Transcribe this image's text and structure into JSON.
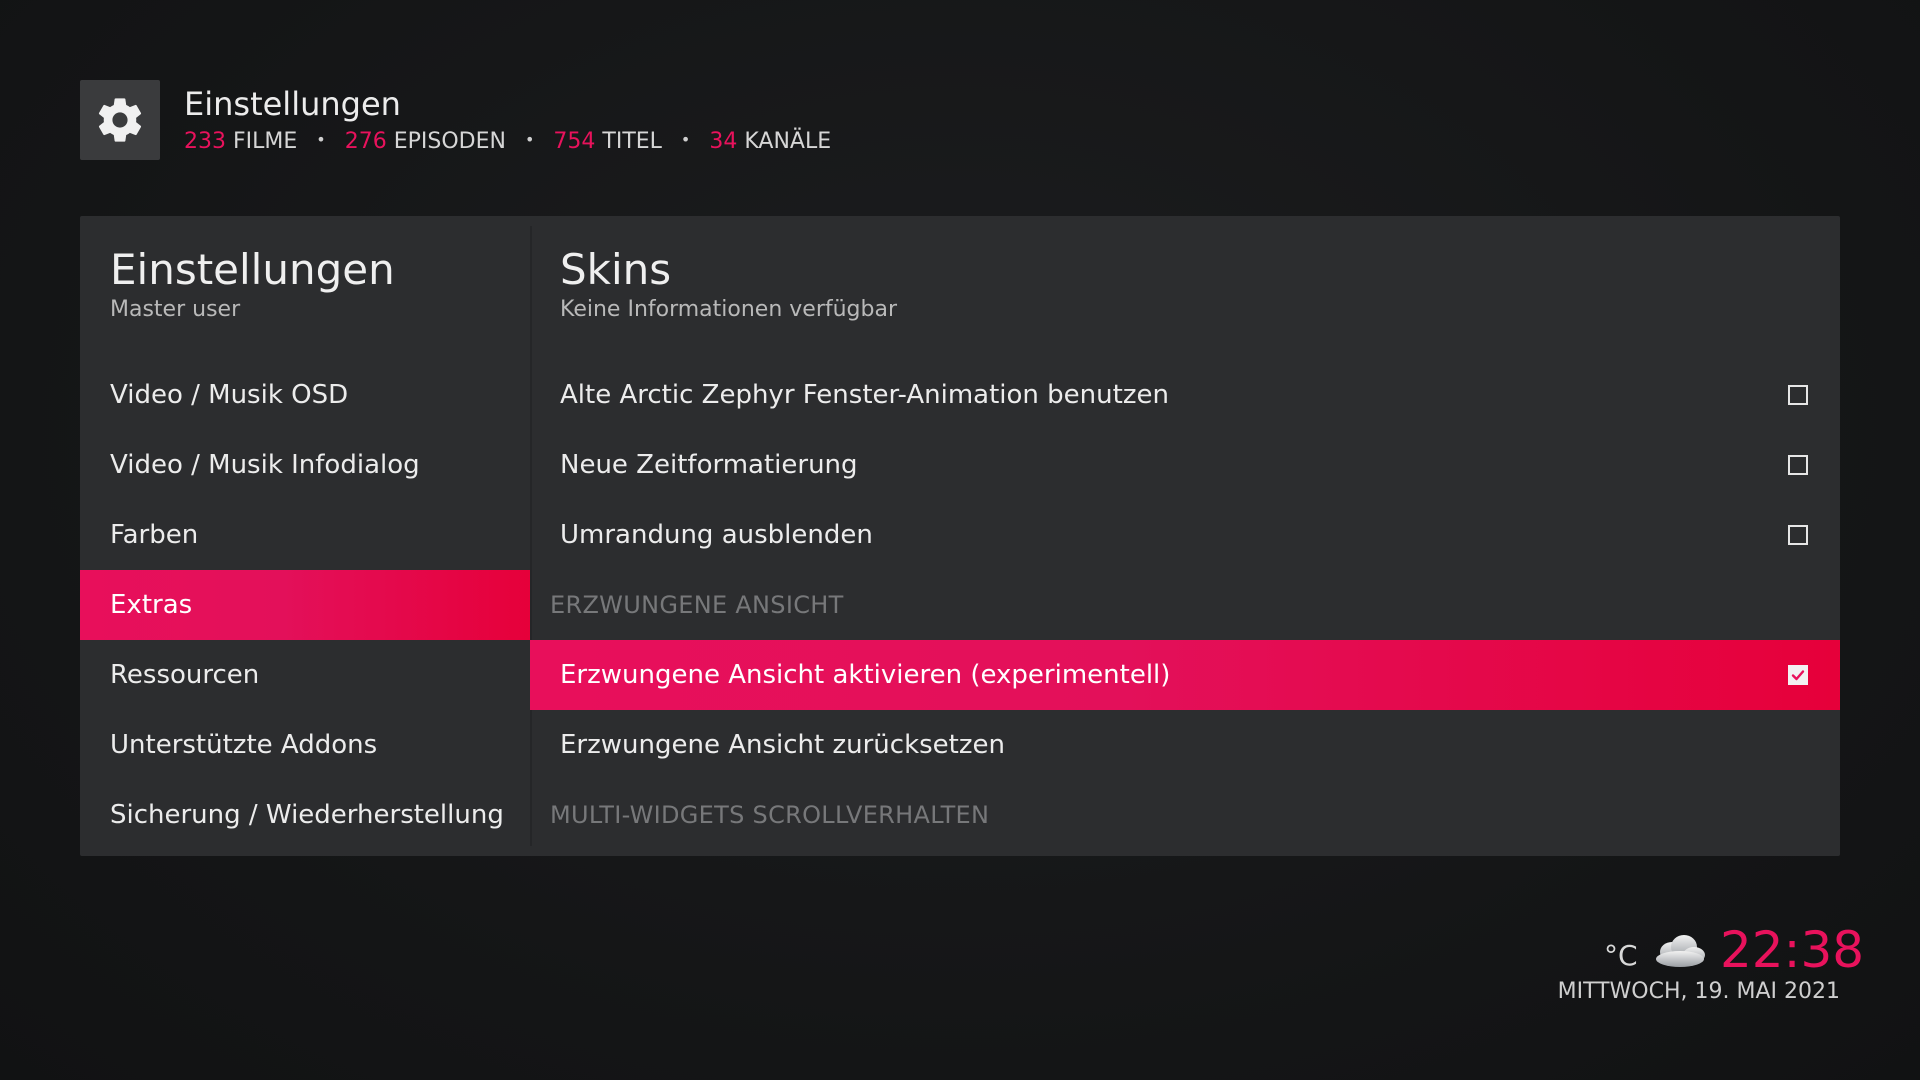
{
  "header": {
    "icon": "gear-icon",
    "title": "Einstellungen",
    "stats": [
      {
        "value": "233",
        "label": "FILME"
      },
      {
        "value": "276",
        "label": "EPISODEN"
      },
      {
        "value": "754",
        "label": "TITEL"
      },
      {
        "value": "34",
        "label": "KANÄLE"
      }
    ],
    "separator": "•"
  },
  "sidebar": {
    "title": "Einstellungen",
    "subtitle": "Master user",
    "items": [
      {
        "label": "Video / Musik OSD",
        "active": false
      },
      {
        "label": "Video / Musik Infodialog",
        "active": false
      },
      {
        "label": "Farben",
        "active": false
      },
      {
        "label": "Extras",
        "active": true
      },
      {
        "label": "Ressourcen",
        "active": false
      },
      {
        "label": "Unterstützte Addons",
        "active": false
      },
      {
        "label": "Sicherung / Wiederherstellung",
        "active": false
      }
    ]
  },
  "content": {
    "title": "Skins",
    "subtitle": "Keine Informationen verfügbar",
    "rows": [
      {
        "type": "option",
        "label": "Alte Arctic Zephyr Fenster-Animation benutzen",
        "checkbox": true,
        "checked": false,
        "active": false
      },
      {
        "type": "option",
        "label": "Neue Zeitformatierung",
        "checkbox": true,
        "checked": false,
        "active": false
      },
      {
        "type": "option",
        "label": "Umrandung ausblenden",
        "checkbox": true,
        "checked": false,
        "active": false
      },
      {
        "type": "section",
        "label": "ERZWUNGENE ANSICHT"
      },
      {
        "type": "option",
        "label": "Erzwungene Ansicht aktivieren (experimentell)",
        "checkbox": true,
        "checked": true,
        "active": true
      },
      {
        "type": "option",
        "label": "Erzwungene Ansicht zurücksetzen",
        "checkbox": false,
        "checked": false,
        "active": false
      },
      {
        "type": "section",
        "label": "MULTI-WIDGETS SCROLLVERHALTEN"
      }
    ]
  },
  "footer": {
    "temperature_unit": "°C",
    "weather_icon": "cloud-icon",
    "time": "22:38",
    "date": "MITTWOCH, 19. MAI 2021"
  },
  "colors": {
    "accent": "#e8125c",
    "panel": "#2c2d2f",
    "background": "#161718"
  }
}
